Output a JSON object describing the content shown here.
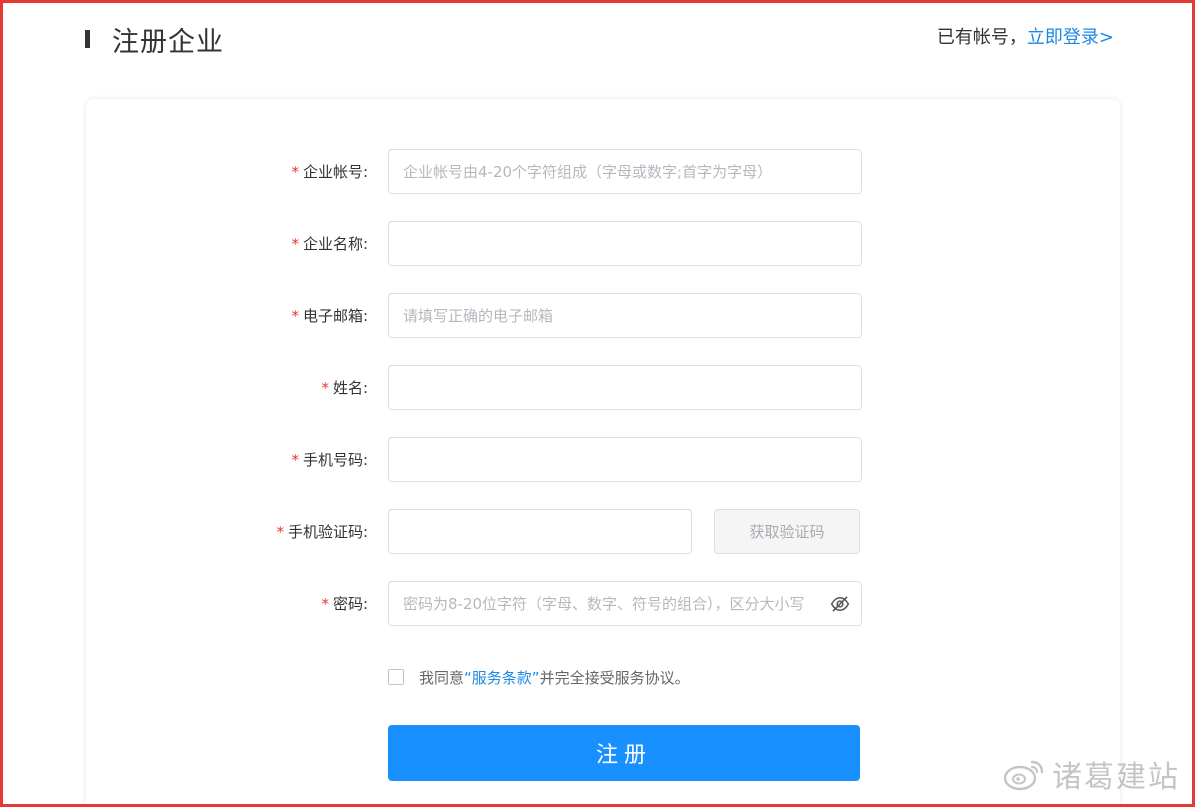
{
  "header": {
    "title": "注册企业",
    "login_prompt": "已有帐号，",
    "login_link": "立即登录>"
  },
  "form": {
    "fields": [
      {
        "label": "企业帐号:",
        "placeholder": "企业帐号由4-20个字符组成（字母或数字;首字为字母）",
        "value": ""
      },
      {
        "label": "企业名称:",
        "placeholder": "",
        "value": ""
      },
      {
        "label": "电子邮箱:",
        "placeholder": "请填写正确的电子邮箱",
        "value": ""
      },
      {
        "label": "姓名:",
        "placeholder": "",
        "value": ""
      },
      {
        "label": "手机号码:",
        "placeholder": "",
        "value": ""
      },
      {
        "label": "手机验证码:",
        "placeholder": "",
        "value": ""
      },
      {
        "label": "密码:",
        "placeholder": "密码为8-20位字符（字母、数字、符号的组合），区分大小写",
        "value": ""
      }
    ],
    "required_mark": "*",
    "sms_button_label": "获取验证码",
    "password_toggle_icon": "eye-off-icon"
  },
  "agreement": {
    "prefix": "我同意",
    "terms_link": "“服务条款”",
    "suffix": "并完全接受服务协议。",
    "checked": false
  },
  "submit": {
    "label": "注册"
  },
  "watermark": {
    "text": "诸葛建站",
    "icon": "weibo-icon"
  },
  "colors": {
    "accent": "#1890ff",
    "link": "#1e88e5",
    "required": "#e53935",
    "frame_border": "#e53935"
  }
}
